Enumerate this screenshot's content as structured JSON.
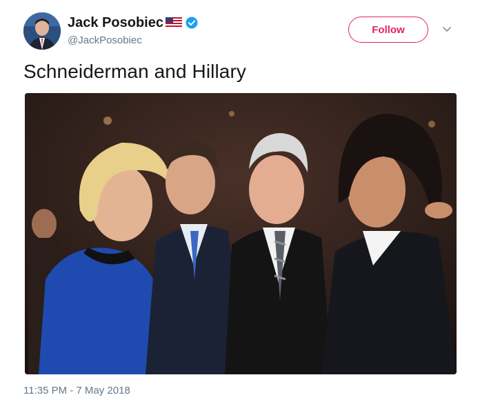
{
  "tweet": {
    "author": {
      "display_name": "Jack Posobiec",
      "handle": "@JackPosobiec",
      "flag_icon": "us-flag-icon",
      "verified_icon": "verified-badge-icon"
    },
    "follow_label": "Follow",
    "menu_icon": "chevron-down-icon",
    "text": "Schneiderman and Hillary",
    "timestamp": "11:35 PM - 7 May 2018"
  },
  "colors": {
    "follow_accent": "#e0245e",
    "verified_blue": "#1da1f2",
    "secondary_text": "#657786"
  }
}
